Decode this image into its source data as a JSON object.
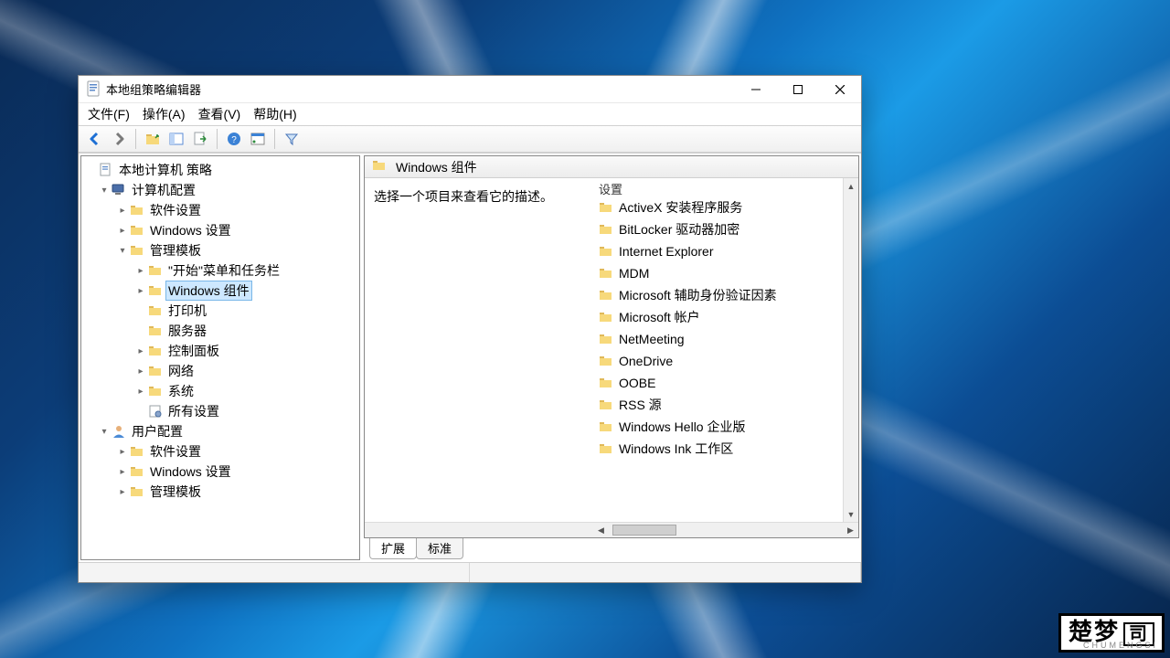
{
  "window": {
    "title": "本地组策略编辑器"
  },
  "menu": {
    "file": "文件(F)",
    "action": "操作(A)",
    "view": "查看(V)",
    "help": "帮助(H)"
  },
  "tree": {
    "root": "本地计算机 策略",
    "computer_cfg": "计算机配置",
    "software_settings": "软件设置",
    "windows_settings": "Windows 设置",
    "admin_templates": "管理模板",
    "start_taskbar": "\"开始\"菜单和任务栏",
    "windows_components": "Windows 组件",
    "printers": "打印机",
    "server": "服务器",
    "control_panel": "控制面板",
    "network": "网络",
    "system": "系统",
    "all_settings": "所有设置",
    "user_cfg": "用户配置",
    "user_software": "软件设置",
    "user_windows": "Windows 设置",
    "user_admin": "管理模板"
  },
  "right": {
    "header_title": "Windows 组件",
    "description_prompt": "选择一个项目来查看它的描述。",
    "column_header": "设置",
    "items": [
      "ActiveX 安装程序服务",
      "BitLocker 驱动器加密",
      "Internet Explorer",
      "MDM",
      "Microsoft 辅助身份验证因素",
      "Microsoft 帐户",
      "NetMeeting",
      "OneDrive",
      "OOBE",
      "RSS 源",
      "Windows Hello 企业版",
      "Windows Ink 工作区"
    ]
  },
  "tabs": {
    "extended": "扩展",
    "standard": "标准"
  },
  "watermark": {
    "main": "楚梦",
    "sub": "CHUMENGSI"
  }
}
